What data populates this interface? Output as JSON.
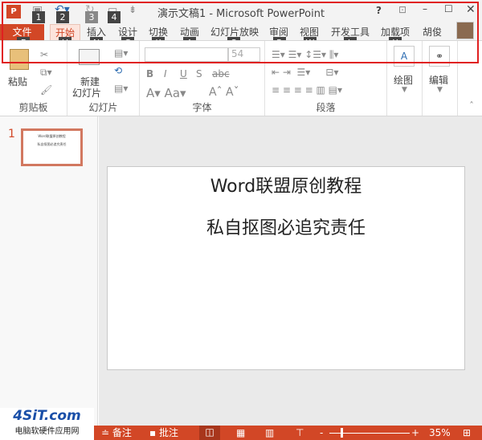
{
  "window": {
    "title": "演示文稿1 - Microsoft PowerPoint",
    "help": "?",
    "user": "胡俊"
  },
  "qat": {
    "keys": [
      "1",
      "2",
      "3",
      "4"
    ]
  },
  "tabs": [
    {
      "label": "文件",
      "key": "F"
    },
    {
      "label": "开始",
      "key": "H"
    },
    {
      "label": "插入",
      "key": "N"
    },
    {
      "label": "设计",
      "key": "G"
    },
    {
      "label": "切换",
      "key": "K"
    },
    {
      "label": "动画",
      "key": "A"
    },
    {
      "label": "幻灯片放映",
      "key": "S"
    },
    {
      "label": "审阅",
      "key": "R"
    },
    {
      "label": "视图",
      "key": "W"
    },
    {
      "label": "开发工具",
      "key": "L"
    },
    {
      "label": "加载项",
      "key": "X"
    }
  ],
  "ribbon": {
    "groups": [
      "剪贴板",
      "幻灯片",
      "字体",
      "段落"
    ],
    "paste": "粘贴",
    "new_slide_1": "新建",
    "new_slide_2": "幻灯片",
    "font_size": "54",
    "drawing": "绘图",
    "editing": "编辑"
  },
  "thumb": {
    "number": "1",
    "line1": "Word联盟原创教程",
    "line2": "私自抠图必追究责任"
  },
  "slide": {
    "line1": "Word联盟原创教程",
    "line2": "私自抠图必追究责任"
  },
  "watermark": {
    "logo": "4SiT.com",
    "sub": "电脑软硬件应用网"
  },
  "status": {
    "notes": "备注",
    "comments": "批注",
    "zoom": "35%"
  },
  "colors": {
    "accent": "#d24726",
    "highlight": "#e02020"
  }
}
